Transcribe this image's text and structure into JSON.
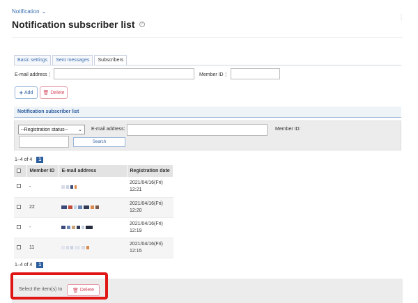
{
  "breadcrumb": {
    "label": "Notification"
  },
  "page": {
    "title": "Notification subscriber list"
  },
  "tabs": [
    {
      "label": "Basic settings"
    },
    {
      "label": "Sent messages"
    },
    {
      "label": "Subscribers"
    }
  ],
  "filters": {
    "email_label": "E-mail address ：",
    "member_label": "Member ID ："
  },
  "actions": {
    "add": "Add",
    "delete": "Delete"
  },
  "section": {
    "title": "Notification subscriber list"
  },
  "search": {
    "status_selected": "--Registration status--",
    "email_label": "E-mail address:",
    "member_label": "Member ID:",
    "button": "Search"
  },
  "pager": {
    "info": "1–4 of 4",
    "current": "1"
  },
  "table": {
    "headers": {
      "member_id": "Member ID",
      "email": "E-mail address",
      "date": "Registration date"
    },
    "rows": [
      {
        "member_id": "-",
        "date_line1": "2021/04/16(Fri)",
        "date_line2": "12:21"
      },
      {
        "member_id": "22",
        "date_line1": "2021/04/16(Fri)",
        "date_line2": "12:20"
      },
      {
        "member_id": "-",
        "date_line1": "2021/04/16(Fri)",
        "date_line2": "12:19"
      },
      {
        "member_id": "11",
        "date_line1": "2021/04/16(Fri)",
        "date_line2": "12:15"
      }
    ]
  },
  "bulk": {
    "label": "Select the item(s) to",
    "delete": "Delete"
  },
  "colors": {
    "accent": "#2d5fa0",
    "danger": "#d44c63",
    "highlight": "#e01515"
  }
}
